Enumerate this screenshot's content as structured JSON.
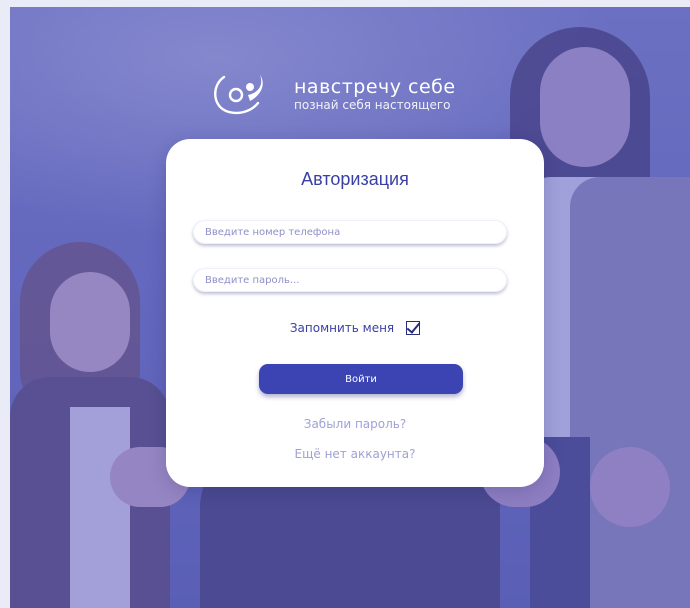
{
  "logo": {
    "brand": "навстречу себе",
    "tagline": "познай себя настоящего",
    "icon": "circle-swirl-logo-icon"
  },
  "auth": {
    "title": "Авторизация",
    "phone_placeholder": "Введите номер телефона",
    "password_placeholder": "Введите пароль...",
    "remember_label": "Запомнить меня",
    "remember_checked": true,
    "login_label": "Войти",
    "forgot_link": "Забыли пароль?",
    "signup_link": "Ещё нет аккаунта?"
  },
  "colors": {
    "accent": "#3c43b2",
    "overlay": "#5c60be",
    "link": "#9ea2d6"
  }
}
